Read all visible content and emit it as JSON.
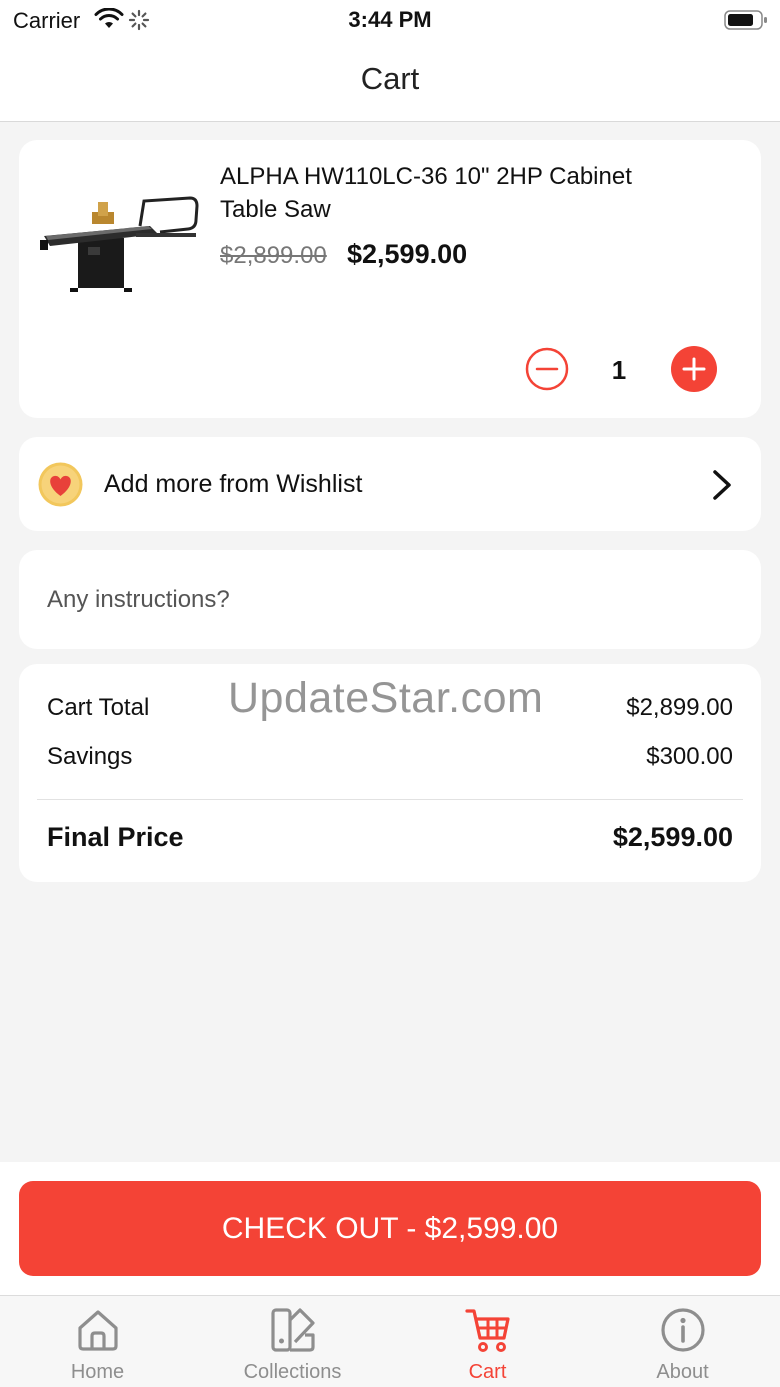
{
  "status_bar": {
    "carrier": "Carrier",
    "time": "3:44 PM"
  },
  "nav": {
    "title": "Cart"
  },
  "cart_item": {
    "title": "ALPHA HW110LC-36 10\" 2HP Cabinet Table Saw",
    "original_price": "$2,899.00",
    "sale_price": "$2,599.00",
    "quantity": "1"
  },
  "wishlist": {
    "label": "Add more from Wishlist",
    "icon": "heart-icon"
  },
  "instructions": {
    "placeholder": "Any instructions?",
    "value": ""
  },
  "summary": {
    "cart_total_label": "Cart Total",
    "cart_total_value": "$2,899.00",
    "savings_label": "Savings",
    "savings_value": "$300.00",
    "final_label": "Final Price",
    "final_value": "$2,599.00"
  },
  "watermark": "UpdateStar.com",
  "checkout": {
    "label": "CHECK OUT - $2,599.00"
  },
  "tabs": [
    {
      "label": "Home",
      "icon": "home-icon",
      "active": false
    },
    {
      "label": "Collections",
      "icon": "collections-icon",
      "active": false
    },
    {
      "label": "Cart",
      "icon": "cart-icon",
      "active": true
    },
    {
      "label": "About",
      "icon": "info-icon",
      "active": false
    }
  ],
  "colors": {
    "accent": "#f44336",
    "background": "#f4f4f4",
    "card": "#ffffff",
    "inactive_tab": "#8e8e8e",
    "wishlist_badge": "#f2c75c"
  }
}
